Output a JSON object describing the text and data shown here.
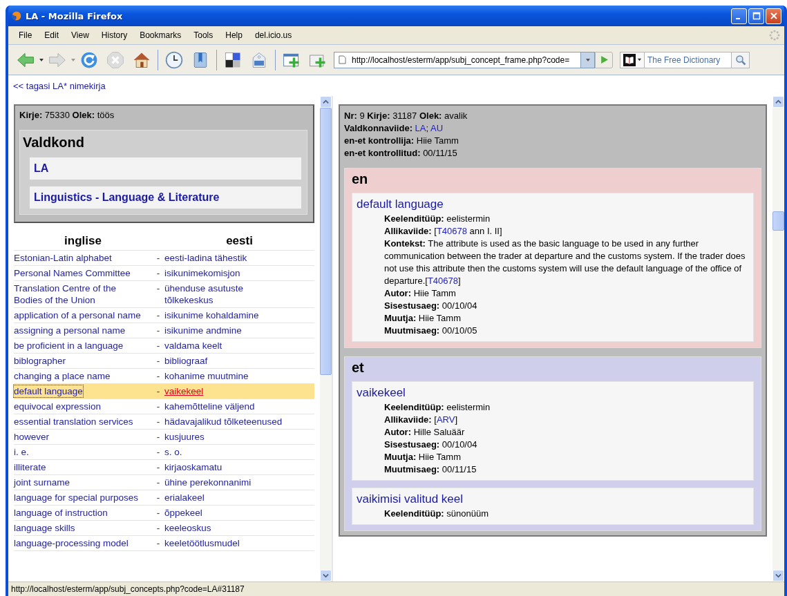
{
  "window": {
    "title": "LA - Mozilla Firefox"
  },
  "menu": [
    "File",
    "Edit",
    "View",
    "History",
    "Bookmarks",
    "Tools",
    "Help",
    "del.icio.us"
  ],
  "toolbar": {
    "url": "http://localhost/esterm/app/subj_concept_frame.php?code=",
    "search": {
      "placeholder": "The Free Dictionary"
    }
  },
  "back_link": "<< tagasi LA* nimekirja",
  "record": {
    "kirje_label": "Kirje:",
    "kirje": "75330",
    "olek_label": "Olek:",
    "olek": "töös"
  },
  "domain": {
    "heading": "Valdkond",
    "items": [
      "LA",
      "Linguistics - Language & Literature"
    ]
  },
  "terms": {
    "columns": [
      "inglise",
      "eesti"
    ],
    "separator": "-",
    "rows": [
      {
        "en": "Estonian-Latin alphabet",
        "et": "eesti-ladina tähestik",
        "selected": false
      },
      {
        "en": "Personal Names Committee",
        "et": "isikunimekomisjon",
        "selected": false
      },
      {
        "en": "Translation Centre of the\nBodies of the Union",
        "et": "ühenduse asutuste\ntõlkekeskus",
        "selected": false
      },
      {
        "en": "application of a personal name",
        "et": "isikunime kohaldamine",
        "selected": false
      },
      {
        "en": "assigning a personal name",
        "et": "isikunime andmine",
        "selected": false
      },
      {
        "en": "be proficient in a language",
        "et": "valdama keelt",
        "selected": false
      },
      {
        "en": "biblographer",
        "et": "bibliograaf",
        "selected": false
      },
      {
        "en": "changing a place name",
        "et": "kohanime muutmine",
        "selected": false
      },
      {
        "en": "default language",
        "et": "vaikekeel",
        "selected": true
      },
      {
        "en": "equivocal expression",
        "et": "kahemõtteline väljend",
        "selected": false
      },
      {
        "en": "essential translation services",
        "et": "hädavajalikud tõlketeenused",
        "selected": false
      },
      {
        "en": "however",
        "et": "kusjuures",
        "selected": false
      },
      {
        "en": "i. e.",
        "et": "s. o.",
        "selected": false
      },
      {
        "en": "illiterate",
        "et": "kirjaoskamatu",
        "selected": false
      },
      {
        "en": "joint surname",
        "et": "ühine perekonnanimi",
        "selected": false
      },
      {
        "en": "language for special purposes",
        "et": "erialakeel",
        "selected": false
      },
      {
        "en": "language of instruction",
        "et": "õppekeel",
        "selected": false
      },
      {
        "en": "language skills",
        "et": "keeleoskus",
        "selected": false
      },
      {
        "en": "language-processing model",
        "et": "keeletöötlusmudel",
        "selected": false
      }
    ]
  },
  "concept": {
    "header_lines": [
      {
        "fields": [
          {
            "label": "Nr:",
            "parts": [
              {
                "kind": "text",
                "text": "9"
              }
            ]
          },
          {
            "label": "Kirje:",
            "parts": [
              {
                "kind": "text",
                "text": "31187"
              }
            ]
          },
          {
            "label": "Olek:",
            "parts": [
              {
                "kind": "text",
                "text": "avalik"
              }
            ]
          }
        ]
      },
      {
        "fields": [
          {
            "label": "Valdkonnaviide:",
            "parts": [
              {
                "kind": "link",
                "text": "LA"
              },
              {
                "kind": "text",
                "text": "; "
              },
              {
                "kind": "link",
                "text": "AU"
              }
            ]
          }
        ]
      },
      {
        "fields": [
          {
            "label": "en-et kontrollija:",
            "parts": [
              {
                "kind": "text",
                "text": "Hiie Tamm"
              }
            ]
          }
        ]
      },
      {
        "fields": [
          {
            "label": "en-et kontrollitud:",
            "parts": [
              {
                "kind": "text",
                "text": "00/11/15"
              }
            ]
          }
        ]
      }
    ],
    "sections": [
      {
        "lang": "en",
        "color": "#eecece",
        "entries": [
          {
            "term": "default language",
            "fields": [
              {
                "label": "Keelenditüüp:",
                "parts": [
                  {
                    "kind": "text",
                    "text": "eelistermin"
                  }
                ]
              },
              {
                "label": "Allikaviide:",
                "parts": [
                  {
                    "kind": "text",
                    "text": "["
                  },
                  {
                    "kind": "link",
                    "text": "T40678"
                  },
                  {
                    "kind": "text",
                    "text": " ann I. II]"
                  }
                ]
              },
              {
                "label": "Kontekst:",
                "parts": [
                  {
                    "kind": "text",
                    "text": "The attribute is used as the basic language to be used in any further communication between the trader at departure and the customs system. If the trader does not use this attribute then the customs system will use the default language of the office of departure.["
                  },
                  {
                    "kind": "link",
                    "text": "T40678"
                  },
                  {
                    "kind": "text",
                    "text": "]"
                  }
                ]
              },
              {
                "label": "Autor:",
                "parts": [
                  {
                    "kind": "text",
                    "text": "Hiie Tamm"
                  }
                ]
              },
              {
                "label": "Sisestusaeg:",
                "parts": [
                  {
                    "kind": "text",
                    "text": "00/10/04"
                  }
                ]
              },
              {
                "label": "Muutja:",
                "parts": [
                  {
                    "kind": "text",
                    "text": "Hiie Tamm"
                  }
                ]
              },
              {
                "label": "Muutmisaeg:",
                "parts": [
                  {
                    "kind": "text",
                    "text": "00/10/05"
                  }
                ]
              }
            ]
          }
        ]
      },
      {
        "lang": "et",
        "color": "#cfcfec",
        "entries": [
          {
            "term": "vaikekeel",
            "fields": [
              {
                "label": "Keelenditüüp:",
                "parts": [
                  {
                    "kind": "text",
                    "text": "eelistermin"
                  }
                ]
              },
              {
                "label": "Allikaviide:",
                "parts": [
                  {
                    "kind": "text",
                    "text": "["
                  },
                  {
                    "kind": "link",
                    "text": "ARV"
                  },
                  {
                    "kind": "text",
                    "text": "]"
                  }
                ]
              },
              {
                "label": "Autor:",
                "parts": [
                  {
                    "kind": "text",
                    "text": "Hille Saluäär"
                  }
                ]
              },
              {
                "label": "Sisestusaeg:",
                "parts": [
                  {
                    "kind": "text",
                    "text": "00/10/04"
                  }
                ]
              },
              {
                "label": "Muutja:",
                "parts": [
                  {
                    "kind": "text",
                    "text": "Hiie Tamm"
                  }
                ]
              },
              {
                "label": "Muutmisaeg:",
                "parts": [
                  {
                    "kind": "text",
                    "text": "00/11/15"
                  }
                ]
              }
            ]
          },
          {
            "term": "vaikimisi valitud keel",
            "fields": [
              {
                "label": "Keelenditüüp:",
                "parts": [
                  {
                    "kind": "text",
                    "text": "sünonüüm"
                  }
                ]
              }
            ]
          }
        ]
      }
    ]
  },
  "status_bar": "http://localhost/esterm/app/subj_concepts.php?code=LA#31187"
}
